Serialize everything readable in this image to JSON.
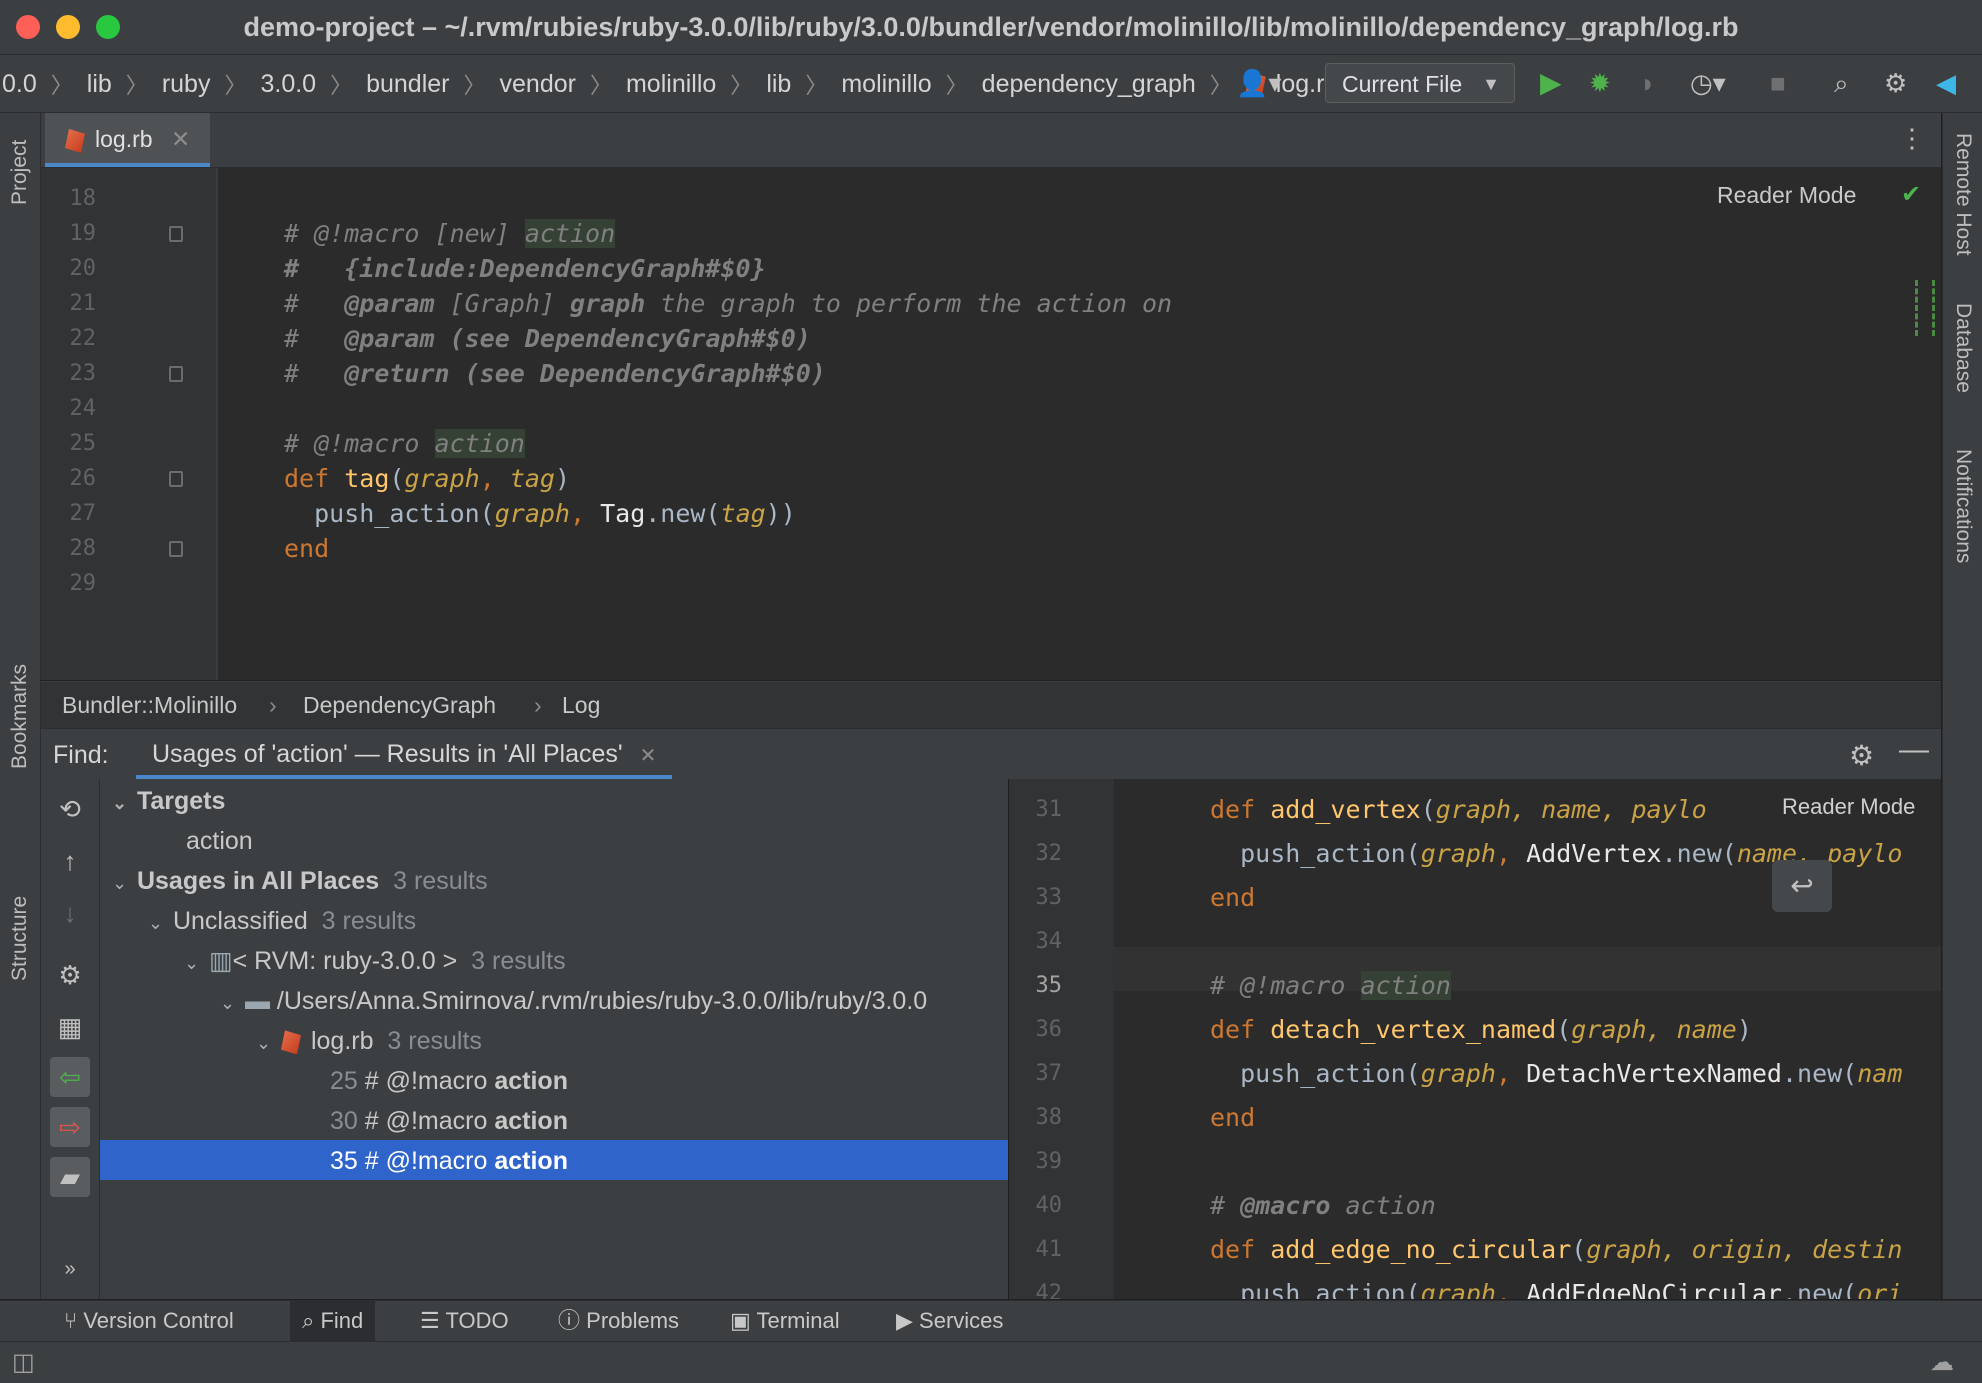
{
  "window": {
    "title": "demo-project – ~/.rvm/rubies/ruby-3.0.0/lib/ruby/3.0.0/bundler/vendor/molinillo/lib/molinillo/dependency_graph/log.rb"
  },
  "nav": {
    "crumbs": [
      "0.0",
      "lib",
      "ruby",
      "3.0.0",
      "bundler",
      "vendor",
      "molinillo",
      "lib",
      "molinillo",
      "dependency_graph",
      "log.rb"
    ],
    "run_config": "Current File"
  },
  "left_stripe": {
    "project": "Project",
    "bookmarks": "Bookmarks",
    "structure": "Structure"
  },
  "right_stripe": {
    "remote_host": "Remote Host",
    "database": "Database",
    "notifications": "Notifications"
  },
  "editor": {
    "tab": "log.rb",
    "reader_mode": "Reader Mode",
    "line_numbers": [
      "18",
      "19",
      "20",
      "21",
      "22",
      "23",
      "24",
      "25",
      "26",
      "27",
      "28",
      "29"
    ],
    "lines": {
      "l19a": "# @!macro [new] ",
      "l19b": "action",
      "l20": "#   {include:DependencyGraph#$0}",
      "l21a": "#   ",
      "l21b": "@param",
      "l21c": " [Graph] ",
      "l21d": "graph",
      "l21e": " the graph to perform the action on",
      "l22a": "#   ",
      "l22b": "@param",
      "l22c": " (see DependencyGraph#$0)",
      "l23a": "#   ",
      "l23b": "@return",
      "l23c": " (see DependencyGraph#$0)",
      "l25a": "# @!macro ",
      "l25b": "action",
      "l26a": "def ",
      "l26b": "tag",
      "l26c": "(",
      "l26d": "graph",
      "l26e": ", ",
      "l26f": "tag",
      "l26g": ")",
      "l27a": "  push_action(",
      "l27b": "graph",
      "l27c": ", ",
      "l27d": "Tag",
      "l27e": ".new(",
      "l27f": "tag",
      "l27g": "))",
      "l28": "end"
    }
  },
  "editor_breadcrumb": [
    "Bundler::Molinillo",
    "DependencyGraph",
    "Log"
  ],
  "find": {
    "label": "Find:",
    "tab": "Usages of 'action' — Results in 'All Places'",
    "tree": {
      "targets": "Targets",
      "target_action": "action",
      "usages": "Usages in All Places",
      "usages_count": "3 results",
      "unclassified": "Unclassified",
      "unclassified_count": "3 results",
      "rvm": "< RVM: ruby-3.0.0 >",
      "rvm_count": "3 results",
      "path": "/Users/Anna.Smirnova/.rvm/rubies/ruby-3.0.0/lib/ruby/3.0.0",
      "file": "log.rb",
      "file_count": "3 results",
      "results": [
        {
          "line": "25",
          "text": " # @!macro ",
          "match": "action"
        },
        {
          "line": "30",
          "text": " # @!macro ",
          "match": "action"
        },
        {
          "line": "35",
          "text": " # @!macro ",
          "match": "action"
        }
      ]
    },
    "preview": {
      "reader_mode": "Reader Mode",
      "line_numbers": [
        "31",
        "32",
        "33",
        "34",
        "35",
        "36",
        "37",
        "38",
        "39",
        "40",
        "41",
        "42"
      ],
      "lines": {
        "p31a": "def ",
        "p31b": "add_vertex",
        "p31c": "(",
        "p31d": "graph, name, paylo",
        "p32a": "  push_action(",
        "p32b": "graph",
        "p32c": ", ",
        "p32d": "AddVertex",
        "p32e": ".new(",
        "p32f": "name, paylo",
        "p33": "end",
        "p35a": "# @!macro ",
        "p35b": "action",
        "p36a": "def ",
        "p36b": "detach_vertex_named",
        "p36c": "(",
        "p36d": "graph, name",
        "p36e": ")",
        "p37a": "  push_action(",
        "p37b": "graph",
        "p37c": ", ",
        "p37d": "DetachVertexNamed",
        "p37e": ".new(",
        "p37f": "nam",
        "p38": "end",
        "p40a": "# ",
        "p40b": "@macro",
        "p40c": " action",
        "p41a": "def ",
        "p41b": "add_edge_no_circular",
        "p41c": "(",
        "p41d": "graph, origin, destin",
        "p42a": "  push_action(",
        "p42b": "graph",
        "p42c": ", ",
        "p42d": "AddEdgeNoCircular",
        "p42e": ".new(",
        "p42f": "ori"
      }
    }
  },
  "bottom_tabs": [
    "Version Control",
    "Find",
    "TODO",
    "Problems",
    "Terminal",
    "Services"
  ]
}
